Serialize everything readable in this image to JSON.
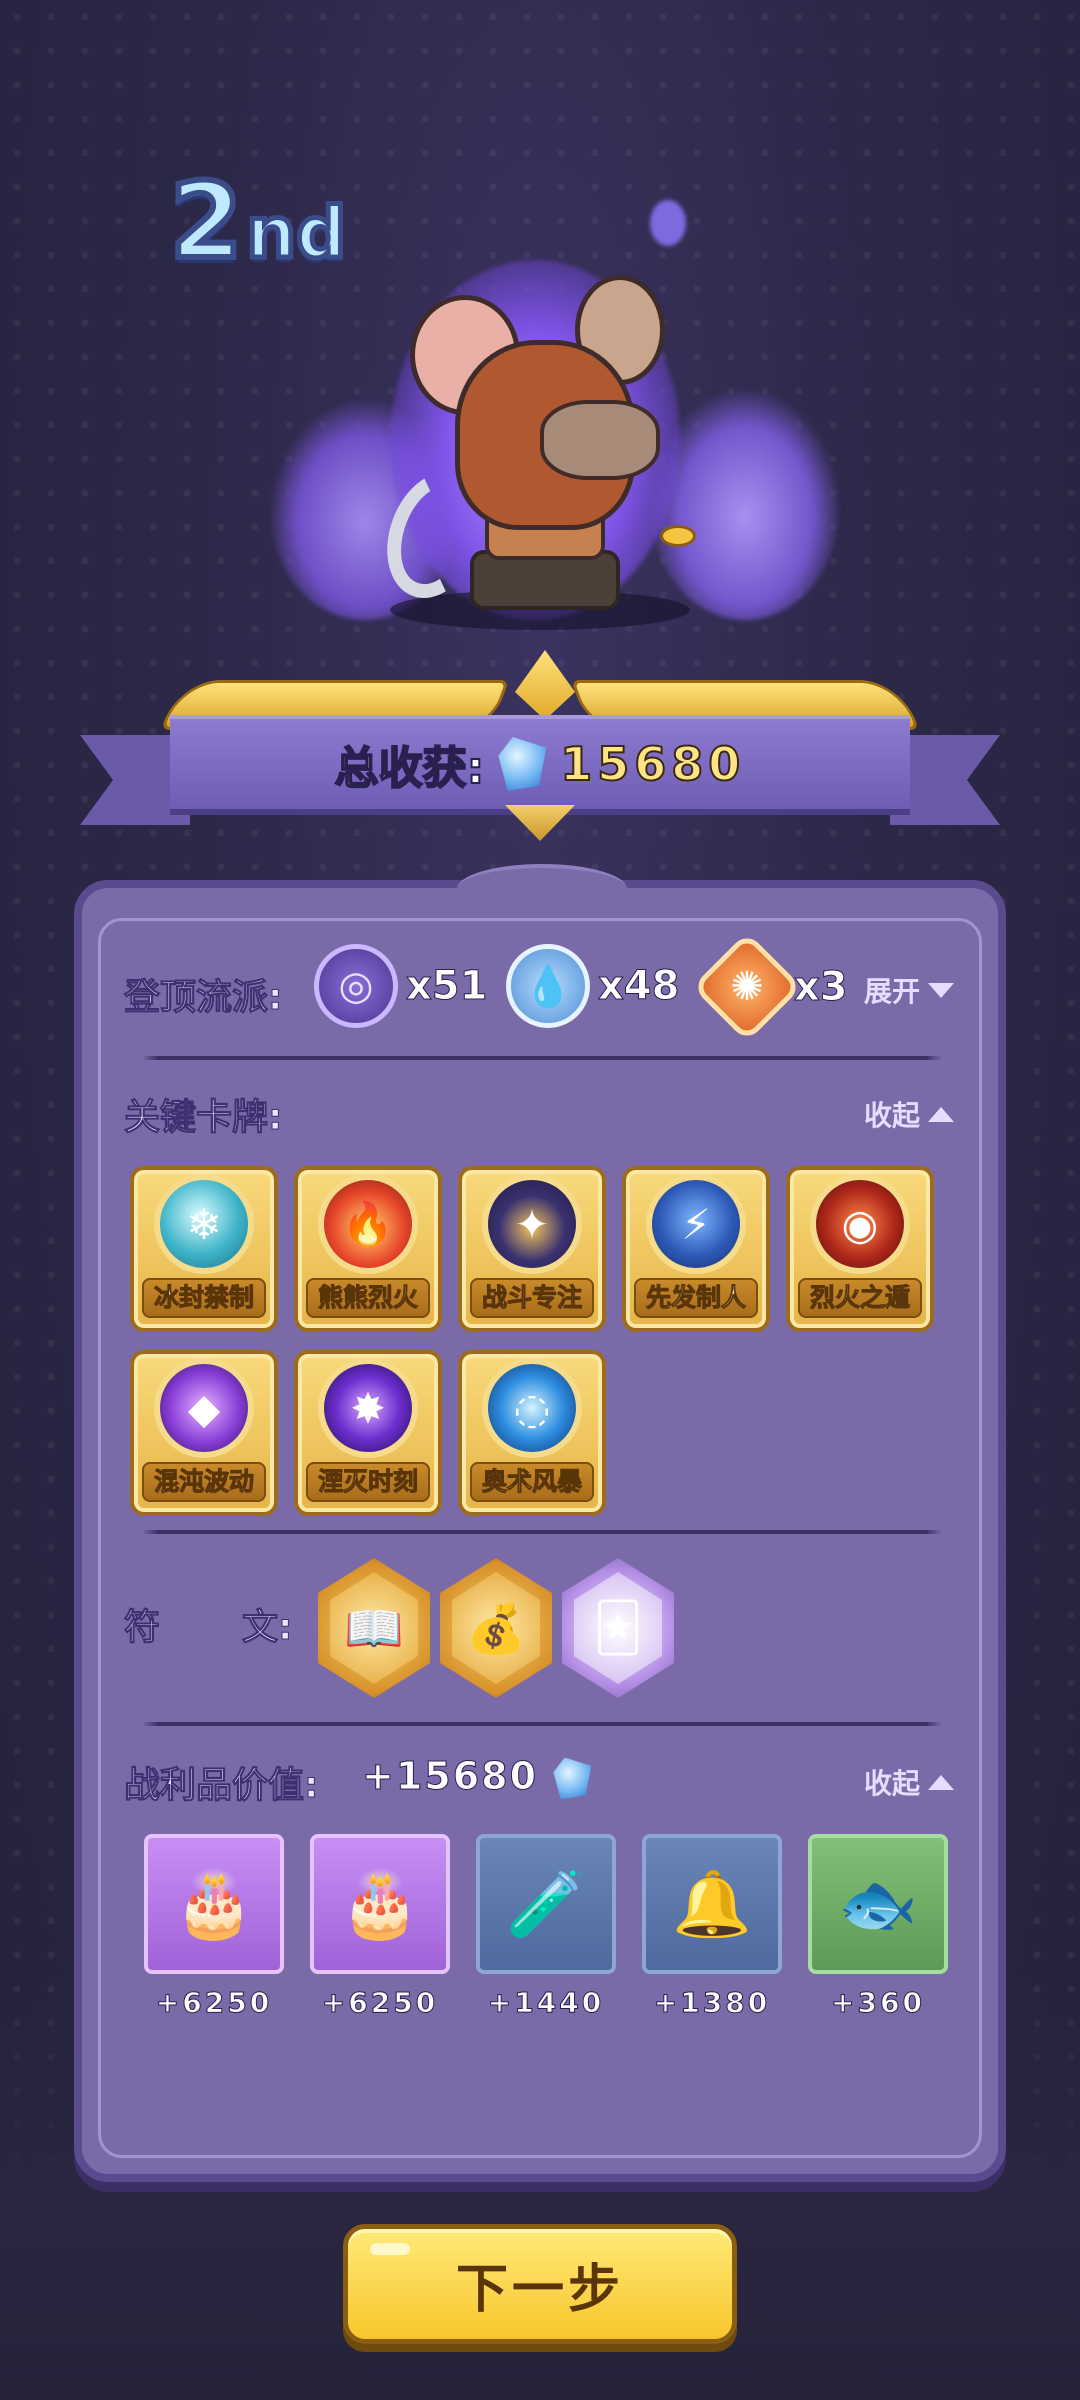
{
  "rank": {
    "number": "2",
    "suffix": "nd"
  },
  "total_harvest": {
    "label": "总收获:",
    "value": "15680"
  },
  "schools": {
    "label": "登顶流派:",
    "items": [
      {
        "icon": "chaos-school-icon",
        "glyph": "◎",
        "count": "x51"
      },
      {
        "icon": "arcane-school-icon",
        "glyph": "💧",
        "count": "x48"
      },
      {
        "icon": "fire-school-icon",
        "glyph": "✺",
        "count": "x3"
      }
    ],
    "toggle_label": "展开"
  },
  "key_cards": {
    "label": "关键卡牌:",
    "toggle_label": "收起",
    "items": [
      {
        "name": "冰封禁制",
        "theme": "ice",
        "glyph": "❄"
      },
      {
        "name": "熊熊烈火",
        "theme": "fire",
        "glyph": "🔥"
      },
      {
        "name": "战斗专注",
        "theme": "focus",
        "glyph": "✦"
      },
      {
        "name": "先发制人",
        "theme": "first",
        "glyph": "⚡"
      },
      {
        "name": "烈火之遁",
        "theme": "shield",
        "glyph": "◉"
      },
      {
        "name": "混沌波动",
        "theme": "chaos",
        "glyph": "◆"
      },
      {
        "name": "湮灭时刻",
        "theme": "void",
        "glyph": "✸"
      },
      {
        "name": "奥术风暴",
        "theme": "storm",
        "glyph": "◌"
      }
    ]
  },
  "runes": {
    "label_left": "符",
    "label_right": "文:",
    "items": [
      {
        "icon": "gold-coins-book-rune-icon",
        "glyph": "📖",
        "style": "gold"
      },
      {
        "icon": "treasure-bag-rune-icon",
        "glyph": "💰",
        "style": "gold"
      },
      {
        "icon": "card-check-rune-icon",
        "glyph": "🃏",
        "style": "silver"
      }
    ]
  },
  "loot": {
    "label": "战利品价值:",
    "value": "+15680",
    "toggle_label": "收起",
    "items": [
      {
        "icon": "treasure-cake-icon",
        "glyph": "🎂",
        "style": "purple",
        "value": "+6250"
      },
      {
        "icon": "treasure-cake-icon",
        "glyph": "🎂",
        "style": "purple",
        "value": "+6250"
      },
      {
        "icon": "potion-bottle-icon",
        "glyph": "🧪",
        "style": "blue",
        "value": "+1440"
      },
      {
        "icon": "bell-icon",
        "glyph": "🔔",
        "style": "blue",
        "value": "+1380"
      },
      {
        "icon": "fish-cake-icon",
        "glyph": "🐟",
        "style": "green",
        "value": "+360"
      }
    ]
  },
  "next_button": {
    "label": "下一步"
  },
  "colors": {
    "panel": "#7a6aa8",
    "panel_border": "#5a4a8e",
    "gold": "#f7c62c",
    "background": "#2c2848"
  }
}
